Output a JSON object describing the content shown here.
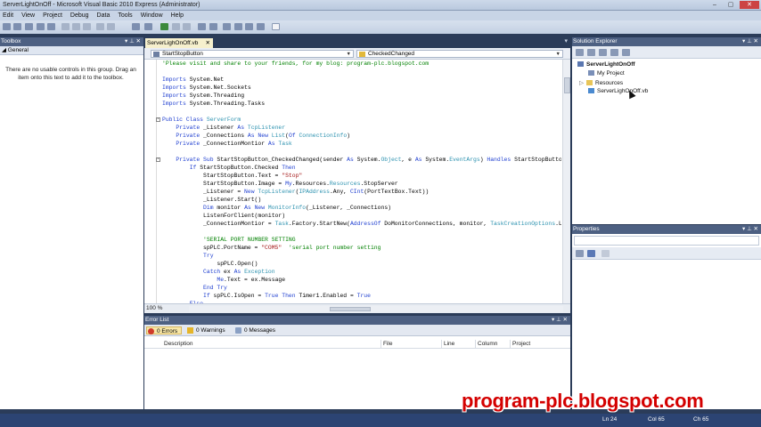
{
  "window": {
    "title": "ServerLightOnOff - Microsoft Visual Basic 2010 Express (Administrator)",
    "controls": [
      "–",
      "▢",
      "✕"
    ]
  },
  "menu": [
    "Edit",
    "View",
    "Project",
    "Debug",
    "Data",
    "Tools",
    "Window",
    "Help"
  ],
  "toolbox": {
    "title": "Toolbox",
    "pin_controls": "▾ ⊥ ✕",
    "group": "◢ General",
    "empty_text": "There are no usable controls in this group. Drag an item onto this text to add it to the toolbox."
  },
  "editor": {
    "tab_label": "ServerLighOnOff.vb",
    "tab_close": "✕",
    "tab_chevron": "▾",
    "object_combo": "StartStopButton",
    "event_combo": "CheckedChanged",
    "zoom": "100 %",
    "code_lines": [
      [
        [
          "cm",
          "'Please visit and share to your friends, for my blog: program-plc.blogspot.com"
        ]
      ],
      [
        [
          "",
          ""
        ]
      ],
      [
        [
          "kw",
          "Imports"
        ],
        [
          "",
          " System.Net"
        ]
      ],
      [
        [
          "kw",
          "Imports"
        ],
        [
          "",
          " System.Net.Sockets"
        ]
      ],
      [
        [
          "kw",
          "Imports"
        ],
        [
          "",
          " System.Threading"
        ]
      ],
      [
        [
          "kw",
          "Imports"
        ],
        [
          "",
          " System.Threading.Tasks"
        ]
      ],
      [
        [
          "",
          ""
        ]
      ],
      [
        [
          "kw",
          "Public Class"
        ],
        [
          "",
          " "
        ],
        [
          "ty",
          "ServerForm"
        ]
      ],
      [
        [
          "",
          "    "
        ],
        [
          "kw",
          "Private"
        ],
        [
          "",
          " _Listener "
        ],
        [
          "kw",
          "As"
        ],
        [
          "",
          " "
        ],
        [
          "ty",
          "TcpListener"
        ]
      ],
      [
        [
          "",
          "    "
        ],
        [
          "kw",
          "Private"
        ],
        [
          "",
          " _Connections "
        ],
        [
          "kw",
          "As New"
        ],
        [
          "",
          " "
        ],
        [
          "ty",
          "List"
        ],
        [
          "",
          "("
        ],
        [
          "kw",
          "Of"
        ],
        [
          "",
          " "
        ],
        [
          "ty",
          "ConnectionInfo"
        ],
        [
          "",
          ")"
        ]
      ],
      [
        [
          "",
          "    "
        ],
        [
          "kw",
          "Private"
        ],
        [
          "",
          " _ConnectionMontior "
        ],
        [
          "kw",
          "As"
        ],
        [
          "",
          " "
        ],
        [
          "ty",
          "Task"
        ]
      ],
      [
        [
          "",
          ""
        ]
      ],
      [
        [
          "",
          "    "
        ],
        [
          "kw",
          "Private Sub"
        ],
        [
          "",
          " StartStopButton_CheckedChanged(sender "
        ],
        [
          "kw",
          "As"
        ],
        [
          "",
          " System."
        ],
        [
          "ty",
          "Object"
        ],
        [
          "",
          ", e "
        ],
        [
          "kw",
          "As"
        ],
        [
          "",
          " System."
        ],
        [
          "ty",
          "EventArgs"
        ],
        [
          "",
          ") "
        ],
        [
          "kw",
          "Handles"
        ],
        [
          "",
          " StartStopButton.CheckedChanged"
        ]
      ],
      [
        [
          "",
          "        "
        ],
        [
          "kw",
          "If"
        ],
        [
          "",
          " StartStopButton.Checked "
        ],
        [
          "kw",
          "Then"
        ]
      ],
      [
        [
          "",
          "            StartStopButton.Text = "
        ],
        [
          "st",
          "\"Stop\""
        ]
      ],
      [
        [
          "",
          "            StartStopButton.Image = "
        ],
        [
          "kw",
          "My"
        ],
        [
          "",
          ".Resources."
        ],
        [
          "ty",
          "Resources"
        ],
        [
          "",
          ".StopServer"
        ]
      ],
      [
        [
          "",
          "            _Listener = "
        ],
        [
          "kw",
          "New"
        ],
        [
          "",
          " "
        ],
        [
          "ty",
          "TcpListener"
        ],
        [
          "",
          "("
        ],
        [
          "ty",
          "IPAddress"
        ],
        [
          "",
          ".Any, "
        ],
        [
          "kw",
          "CInt"
        ],
        [
          "",
          "(PortTextBox.Text))"
        ]
      ],
      [
        [
          "",
          "            _Listener.Start()"
        ]
      ],
      [
        [
          "",
          "            "
        ],
        [
          "kw",
          "Dim"
        ],
        [
          "",
          " monitor "
        ],
        [
          "kw",
          "As New"
        ],
        [
          "",
          " "
        ],
        [
          "ty",
          "MonitorInfo"
        ],
        [
          "",
          "(_Listener, _Connections)"
        ]
      ],
      [
        [
          "",
          "            ListenForClient(monitor)"
        ]
      ],
      [
        [
          "",
          "            _ConnectionMontior = "
        ],
        [
          "ty",
          "Task"
        ],
        [
          "",
          ".Factory.StartNew("
        ],
        [
          "kw",
          "AddressOf"
        ],
        [
          "",
          " DoMonitorConnections, monitor, "
        ],
        [
          "ty",
          "TaskCreationOptions"
        ],
        [
          "",
          ".LongRunning)"
        ]
      ],
      [
        [
          "",
          ""
        ]
      ],
      [
        [
          "",
          "            "
        ],
        [
          "cm",
          "'SERIAL PORT NUMBER SETTING"
        ]
      ],
      [
        [
          "",
          "            spPLC.PortName = "
        ],
        [
          "st",
          "\"COM5\""
        ],
        [
          "",
          "  "
        ],
        [
          "cm",
          "'serial port number setting"
        ]
      ],
      [
        [
          "",
          "            "
        ],
        [
          "kw",
          "Try"
        ]
      ],
      [
        [
          "",
          "                spPLC.Open()"
        ]
      ],
      [
        [
          "",
          "            "
        ],
        [
          "kw",
          "Catch"
        ],
        [
          "",
          " ex "
        ],
        [
          "kw",
          "As"
        ],
        [
          "",
          " "
        ],
        [
          "ty",
          "Exception"
        ]
      ],
      [
        [
          "",
          "                "
        ],
        [
          "kw",
          "Me"
        ],
        [
          "",
          ".Text = ex.Message"
        ]
      ],
      [
        [
          "",
          "            "
        ],
        [
          "kw",
          "End Try"
        ]
      ],
      [
        [
          "",
          "            "
        ],
        [
          "kw",
          "If"
        ],
        [
          "",
          " spPLC.IsOpen = "
        ],
        [
          "kw",
          "True Then"
        ],
        [
          "",
          " Timer1.Enabled = "
        ],
        [
          "kw",
          "True"
        ]
      ],
      [
        [
          "",
          "        "
        ],
        [
          "kw",
          "Else"
        ]
      ]
    ]
  },
  "error_list": {
    "title": "Error List",
    "controls": "▾ ⊥ ✕",
    "errors": "0 Errors",
    "warnings": "0 Warnings",
    "messages": "0 Messages",
    "columns": [
      "Description",
      "File",
      "Line",
      "Column",
      "Project"
    ]
  },
  "solution_explorer": {
    "title": "Solution Explorer",
    "controls": "▾ ⊥ ✕",
    "items": [
      "ServerLightOnOff",
      "My Project",
      "Resources",
      "ServerLighOnOff.vb"
    ]
  },
  "properties": {
    "title": "Properties",
    "controls": "▾ ⊥ ✕"
  },
  "status": {
    "ln": "Ln 24",
    "col": "Col 65",
    "ch": "Ch 65"
  },
  "watermark": "program-plc.blogspot.com",
  "colors": {
    "chrome": "#2b3c59",
    "keyword": "#1f3fd0",
    "type": "#2b91af",
    "string": "#a31515",
    "comment": "#008000",
    "watermark": "#d40000"
  }
}
